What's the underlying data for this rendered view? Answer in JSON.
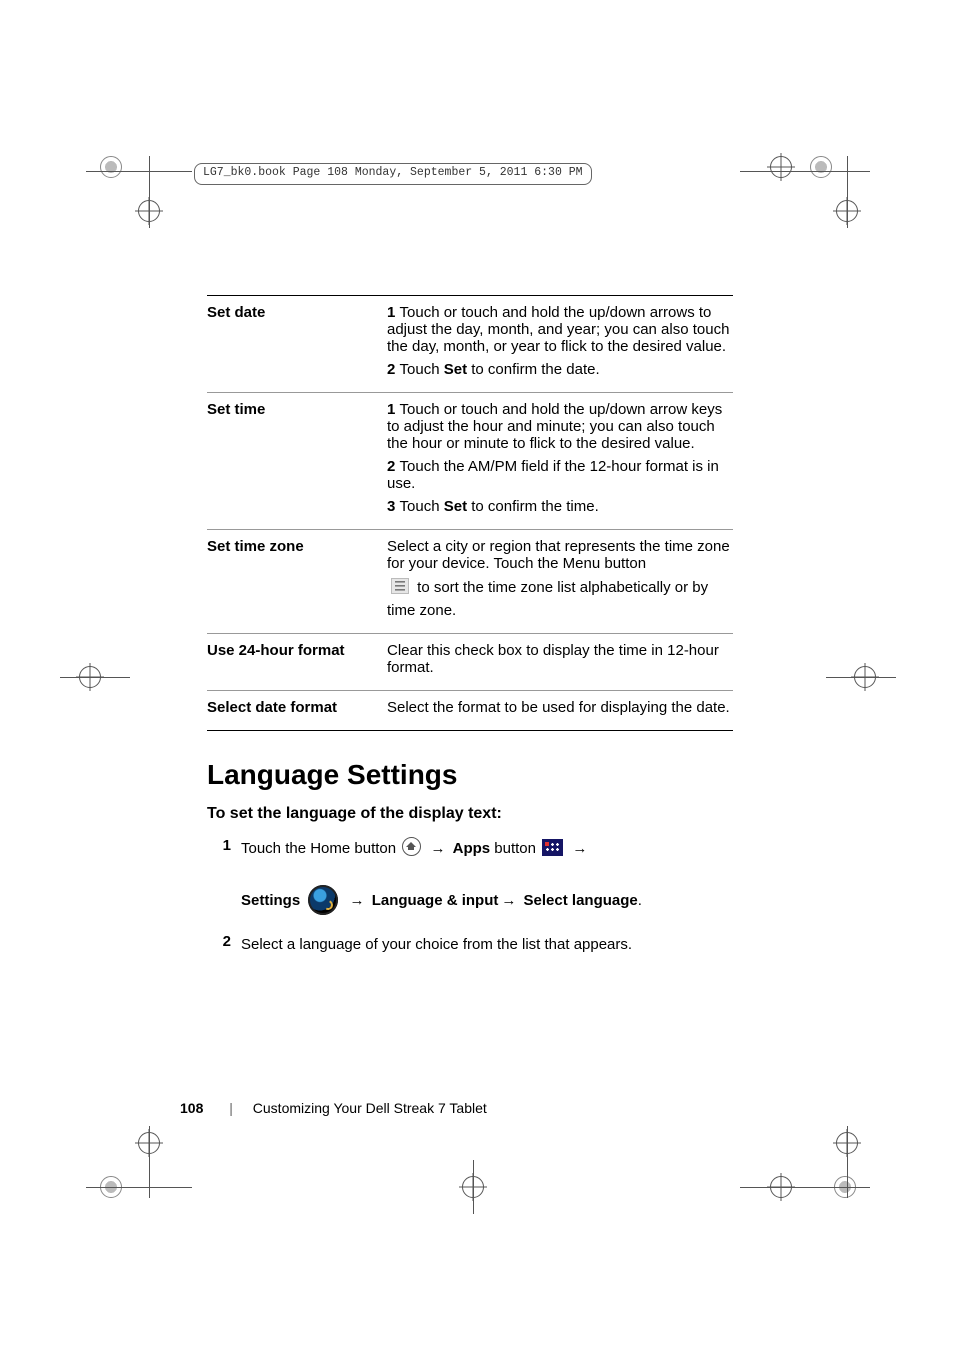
{
  "file_tag": "LG7_bk0.book  Page 108  Monday, September 5, 2011  6:30 PM",
  "table": [
    {
      "label": "Set date",
      "lines": [
        {
          "type": "step",
          "num": "1",
          "text": "Touch or touch and hold the up/down arrows to adjust the day, month, and year; you can also touch the day, month, or year to flick to the desired value."
        },
        {
          "type": "step",
          "num": "2",
          "prefix": "Touch ",
          "bold": "Set",
          "suffix": " to confirm the date."
        }
      ]
    },
    {
      "label": "Set time",
      "lines": [
        {
          "type": "step",
          "num": "1",
          "text": "Touch or touch and hold the up/down arrow keys to adjust the hour and minute; you can also touch the hour or minute to flick to the desired value."
        },
        {
          "type": "step",
          "num": "2",
          "text": "Touch the AM/PM field if the 12-hour format is in use."
        },
        {
          "type": "step",
          "num": "3",
          "prefix": "Touch ",
          "bold": "Set",
          "suffix": " to confirm the time."
        }
      ]
    },
    {
      "label": "Set time zone",
      "lines": [
        {
          "type": "plain",
          "text": "Select a city or region that represents the time zone for your device. Touch the Menu button"
        },
        {
          "type": "menu-line",
          "after_icon": " to sort the time zone list alphabetically or by"
        },
        {
          "type": "plain",
          "text": "time zone."
        }
      ]
    },
    {
      "label": "Use 24-hour format",
      "lines": [
        {
          "type": "plain",
          "text": "Clear this check box to display the time in 12-hour format."
        }
      ]
    },
    {
      "label": "Select date format",
      "lines": [
        {
          "type": "plain",
          "text": "Select the format to be used for displaying the date."
        }
      ]
    }
  ],
  "section_title": "Language Settings",
  "subhead": "To set the language of the display text:",
  "step1": {
    "num": "1",
    "lead": "Touch the Home button ",
    "arrow": "→",
    "apps_bold": "Apps",
    "apps_after": " button ",
    "line2_settings": "Settings",
    "line2_lang": "Language & input",
    "line2_select": "Select language",
    "period": "."
  },
  "step2": {
    "num": "2",
    "text": "Select a language of your choice from the list that appears."
  },
  "footer": {
    "page": "108",
    "chapter": "Customizing Your Dell Streak 7 Tablet"
  }
}
